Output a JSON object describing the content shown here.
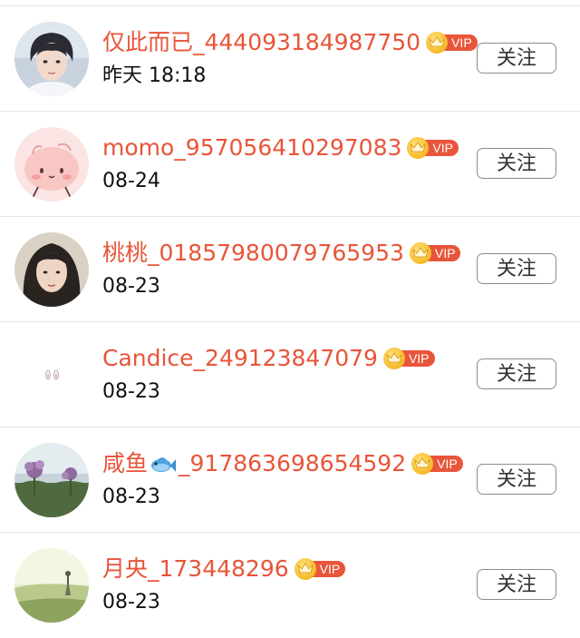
{
  "users": [
    {
      "name": "仅此而已_444093184987750",
      "vip_label": "VIP",
      "time": "昨天 18:18",
      "follow_label": "关注",
      "avatar": "avatar-man-portrait"
    },
    {
      "name": "momo_957056410297083",
      "vip_label": "VIP",
      "time": "08-24",
      "follow_label": "关注",
      "avatar": "avatar-pink-cartoon"
    },
    {
      "name": "桃桃_01857980079765953",
      "vip_label": "VIP",
      "time": "08-23",
      "follow_label": "关注",
      "avatar": "avatar-woman-portrait"
    },
    {
      "name": "Candice_249123847079",
      "vip_label": "VIP",
      "time": "08-23",
      "follow_label": "关注",
      "avatar": "avatar-bunny-ears"
    },
    {
      "name_prefix": "咸鱼",
      "name_emoji": "fish-emoji",
      "name_suffix": "_917863698654592",
      "vip_label": "VIP",
      "time": "08-23",
      "follow_label": "关注",
      "avatar": "avatar-flowers-photo"
    },
    {
      "name": "月央_173448296",
      "vip_label": "VIP",
      "time": "08-23",
      "follow_label": "关注",
      "avatar": "avatar-landscape-photo"
    }
  ],
  "colors": {
    "name": "#e8553a",
    "vip_pill": "#e8553a",
    "crown": "#f6b928",
    "divider": "#e6e6e6",
    "button_border": "#8c8c8c"
  }
}
